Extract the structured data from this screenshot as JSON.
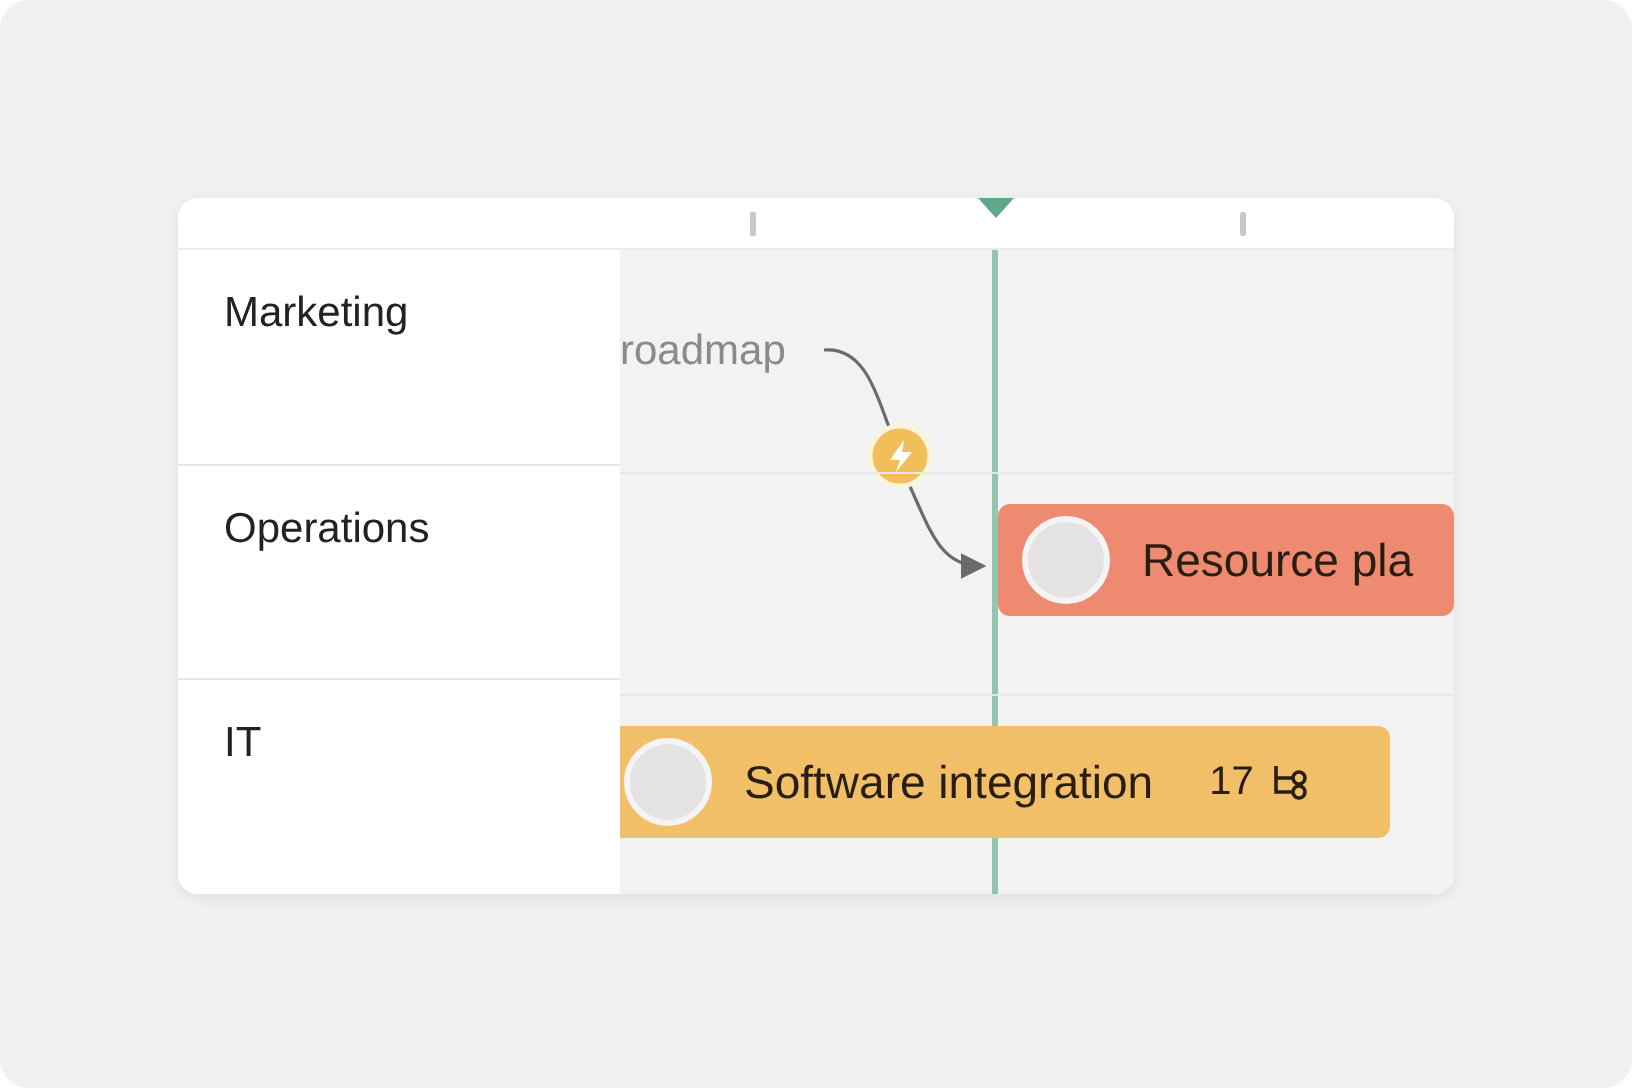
{
  "rows": [
    {
      "label": "Marketing",
      "tasks": [
        {
          "kind": "label",
          "title": "roadmap"
        }
      ]
    },
    {
      "label": "Operations",
      "tasks": [
        {
          "kind": "bar",
          "title": "Resource pla",
          "color": "#ee8a6f"
        }
      ]
    },
    {
      "label": "IT",
      "tasks": [
        {
          "kind": "bar",
          "title": "Software integration",
          "color": "#f0bf68",
          "count": "17"
        }
      ]
    }
  ]
}
